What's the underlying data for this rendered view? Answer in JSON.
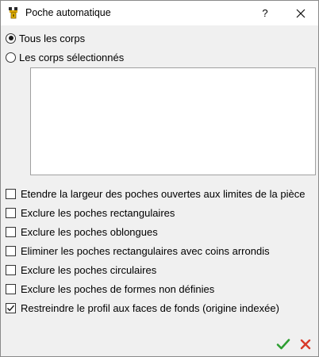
{
  "window": {
    "title": "Poche automatique",
    "help_label": "?"
  },
  "scope": {
    "options": [
      {
        "label": "Tous les corps",
        "checked": true
      },
      {
        "label": "Les corps sélectionnés",
        "checked": false
      }
    ]
  },
  "options": [
    {
      "label": "Etendre la largeur des poches ouvertes aux limites de la pièce",
      "checked": false
    },
    {
      "label": "Exclure les poches rectangulaires",
      "checked": false
    },
    {
      "label": "Exclure les poches oblongues",
      "checked": false
    },
    {
      "label": "Eliminer les poches rectangulaires avec coins arrondis",
      "checked": false
    },
    {
      "label": "Exclure les poches circulaires",
      "checked": false
    },
    {
      "label": "Exclure les poches de formes non définies",
      "checked": false
    },
    {
      "label": "Restreindre le profil aux faces de fonds (origine indexée)",
      "checked": true
    }
  ],
  "colors": {
    "ok": "#2e9e32",
    "cancel": "#d83a2a"
  }
}
